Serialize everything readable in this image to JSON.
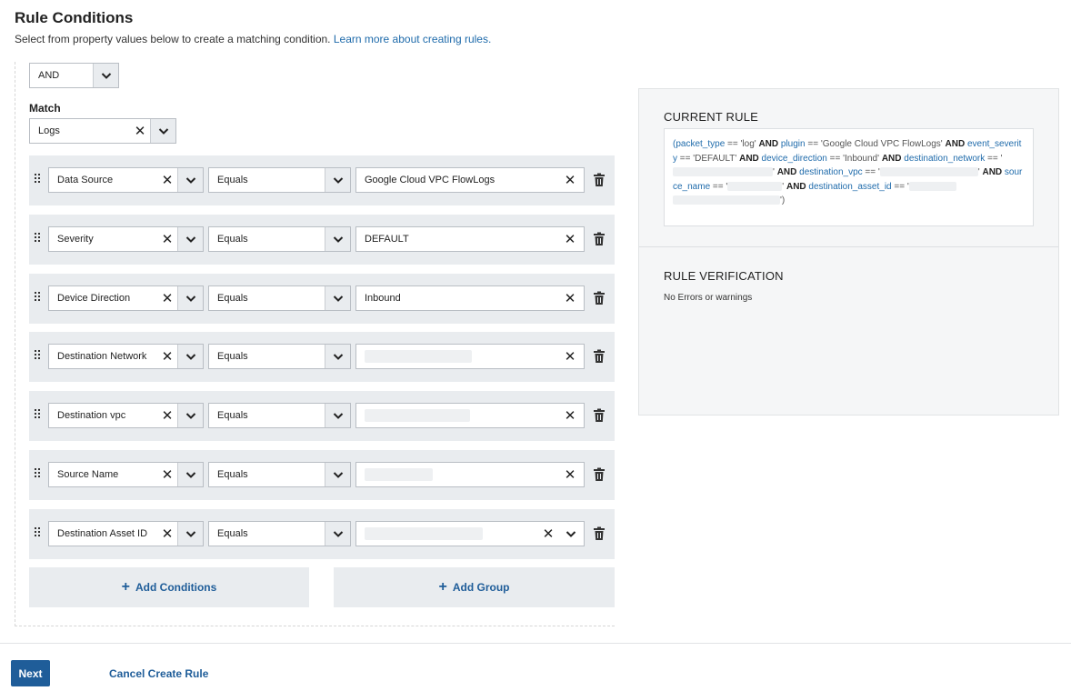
{
  "page": {
    "title": "Rule Conditions",
    "subtitle": "Select from property values below to create a matching condition.",
    "learn_more": "Learn more about creating rules."
  },
  "builder": {
    "logic_operator": "AND",
    "match_label": "Match",
    "match_value": "Logs",
    "conditions": [
      {
        "field": "Data Source",
        "operator": "Equals",
        "value": "Google Cloud VPC FlowLogs"
      },
      {
        "field": "Severity",
        "operator": "Equals",
        "value": "DEFAULT"
      },
      {
        "field": "Device Direction",
        "operator": "Equals",
        "value": "Inbound"
      },
      {
        "field": "Destination Network",
        "operator": "Equals",
        "value": ""
      },
      {
        "field": "Destination vpc",
        "operator": "Equals",
        "value": ""
      },
      {
        "field": "Source Name",
        "operator": "Equals",
        "value": ""
      },
      {
        "field": "Destination Asset ID",
        "operator": "Equals",
        "value": ""
      }
    ],
    "add_conditions_label": "Add Conditions",
    "add_group_label": "Add Group"
  },
  "current_rule": {
    "heading": "CURRENT RULE",
    "parts": {
      "p1": "(packet_type",
      "p2": " == 'log' ",
      "p3": "AND",
      "p4": " plugin",
      "p5": " == 'Google Cloud VPC FlowLogs' ",
      "p6": "AND",
      "p7": " event_severity",
      "p8": " == 'DEFAULT' ",
      "p9": "AND",
      "p10": " device_direction",
      "p11": " == 'Inbound' ",
      "p12": "AND",
      "p13": " destination_network",
      "p14": " == '",
      "p15": "' ",
      "p16": "AND",
      "p17": " destination_vpc",
      "p18": " == '",
      "p19": "' ",
      "p20": "AND",
      "p21": " source_name",
      "p22": " == '",
      "p23": "' ",
      "p24": "AND",
      "p25": " destination_asset_id",
      "p26": " == '",
      "p27": "')"
    }
  },
  "verification": {
    "heading": "RULE VERIFICATION",
    "message": "No Errors or warnings"
  },
  "footer": {
    "next_label": "Next",
    "cancel_label": "Cancel Create Rule"
  }
}
